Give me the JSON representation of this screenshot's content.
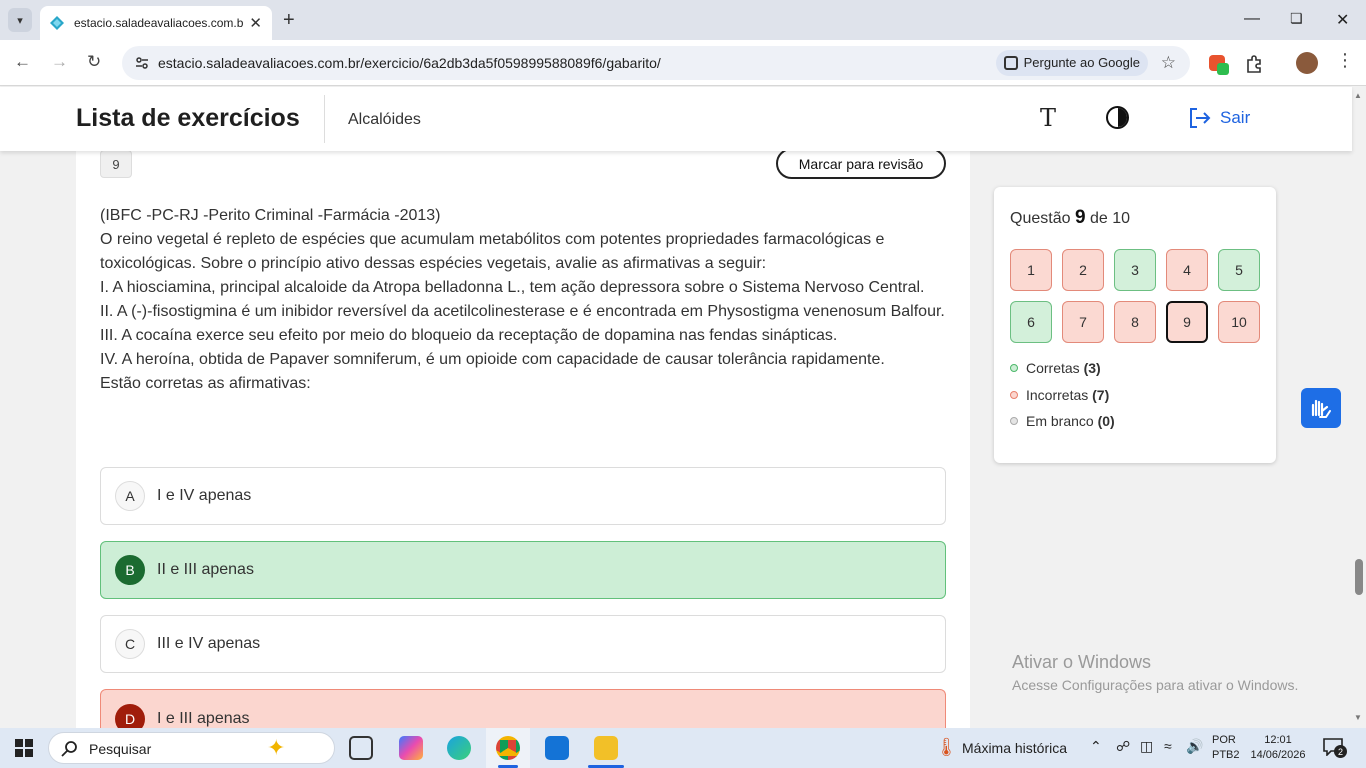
{
  "browser": {
    "tab_title": "estacio.saladeavaliacoes.com.br",
    "url": "estacio.saladeavaliacoes.com.br/exercicio/6a2db3da5f059899588089f6/gabarito/",
    "ask_google": "Pergunte ao Google"
  },
  "header": {
    "title": "Lista de exercícios",
    "subtitle": "Alcalóides",
    "logout_label": "Sair"
  },
  "question": {
    "number": "9",
    "review_button": "Marcar para revisão",
    "lines": [
      "(IBFC -PC-RJ -Perito Criminal -Farmácia -2013)",
      "O reino vegetal é repleto de espécies que acumulam metabólitos com potentes propriedades farmacológicas e toxicológicas. Sobre o princípio ativo dessas espécies vegetais, avalie as afirmativas a seguir:",
      "I. A hiosciamina, principal alcaloide da Atropa belladonna L., tem ação depressora sobre o Sistema Nervoso Central.",
      "II. A (-)-fisostigmina é um inibidor reversível da acetilcolinesterase e é encontrada em Physostigma venenosum Balfour.",
      "III. A cocaína exerce seu efeito por meio do bloqueio da receptação de dopamina nas fendas sinápticas.",
      "IV. A heroína, obtida de Papaver somniferum, é um opioide com capacidade de causar tolerância rapidamente.",
      "Estão corretas as afirmativas:"
    ],
    "options": [
      {
        "letter": "A",
        "text": "I e IV apenas",
        "state": "neutral"
      },
      {
        "letter": "B",
        "text": "II e III apenas",
        "state": "correct"
      },
      {
        "letter": "C",
        "text": "III e IV apenas",
        "state": "neutral"
      },
      {
        "letter": "D",
        "text": "I e III apenas",
        "state": "wrong"
      }
    ]
  },
  "panel": {
    "prefix": "Questão",
    "current": "9",
    "suffix": "de 10",
    "buttons": [
      {
        "label": "1",
        "state": "wrong"
      },
      {
        "label": "2",
        "state": "wrong"
      },
      {
        "label": "3",
        "state": "right"
      },
      {
        "label": "4",
        "state": "wrong"
      },
      {
        "label": "5",
        "state": "right"
      },
      {
        "label": "6",
        "state": "right"
      },
      {
        "label": "7",
        "state": "wrong"
      },
      {
        "label": "8",
        "state": "wrong"
      },
      {
        "label": "9",
        "state": "wrong-current"
      },
      {
        "label": "10",
        "state": "wrong"
      }
    ],
    "legend": {
      "correct_label": "Corretas",
      "correct_count": "(3)",
      "wrong_label": "Incorretas",
      "wrong_count": "(7)",
      "blank_label": "Em branco",
      "blank_count": "(0)"
    }
  },
  "watermark": {
    "line1": "Ativar o Windows",
    "line2": "Acesse Configurações para ativar o Windows."
  },
  "taskbar": {
    "search_label": "Pesquisar",
    "weather": "Máxima histórica",
    "lang1": "POR",
    "lang2": "PTB2",
    "time": "12:01",
    "date": "14/06/2026",
    "notifications": "2"
  },
  "colors": {
    "accent": "#1e63e0",
    "correct_bg": "#cdeed6",
    "wrong_bg": "#fbd6cf"
  }
}
